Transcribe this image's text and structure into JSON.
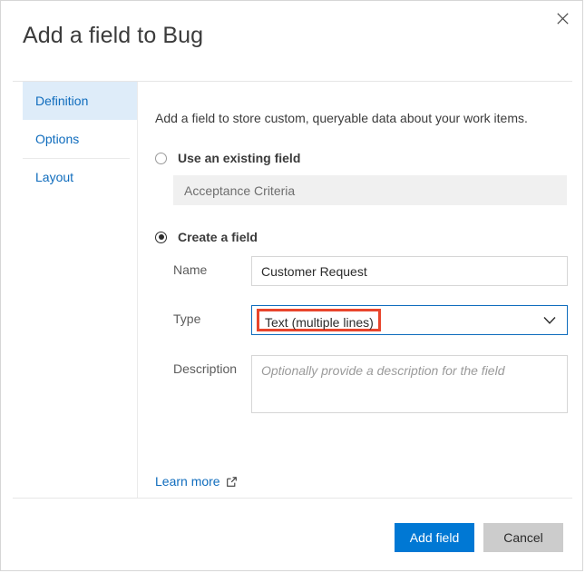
{
  "dialog": {
    "title": "Add a field to Bug",
    "close_icon": "close-icon"
  },
  "tabs": [
    {
      "label": "Definition",
      "selected": true
    },
    {
      "label": "Options",
      "selected": false
    },
    {
      "label": "Layout",
      "selected": false
    }
  ],
  "content": {
    "intro": "Add a field to store custom, queryable data about your work items.",
    "existing_field": {
      "radio_label": "Use an existing field",
      "selected": false,
      "value": "Acceptance Criteria",
      "disabled": true
    },
    "create_field": {
      "radio_label": "Create a field",
      "selected": true,
      "name": {
        "label": "Name",
        "value": "Customer Request",
        "placeholder": ""
      },
      "type": {
        "label": "Type",
        "value": "Text (multiple lines)",
        "chevron_icon": "chevron-down-icon",
        "focused": true,
        "annotated": true,
        "annotation_color": "#e8452c"
      },
      "description": {
        "label": "Description",
        "value": "",
        "placeholder": "Optionally provide a description for the field"
      }
    },
    "learn_more": {
      "label": "Learn more",
      "icon": "external-link-icon"
    }
  },
  "footer": {
    "primary_label": "Add field",
    "secondary_label": "Cancel"
  },
  "colors": {
    "accent": "#0078d4",
    "link": "#0f6cbd",
    "tab_selected_bg": "#deecf9",
    "annotation": "#e8452c",
    "disabled_bg": "#f0f0f0",
    "secondary_button_bg": "#cccccc"
  }
}
